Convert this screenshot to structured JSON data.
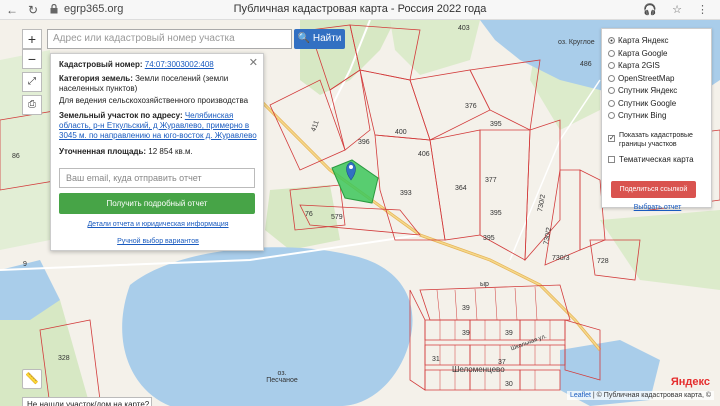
{
  "browser": {
    "url": "egrp365.org",
    "tab_title": "Публичная кадастровая карта - Россия 2022 года"
  },
  "map": {
    "zoom_in": "+",
    "zoom_out": "−",
    "search_placeholder": "Адрес или кадастровый номер участка",
    "search_button": "Найти",
    "not_found_label": "Не нашли участок/дом на карте?",
    "attribution_leaflet": "Leaflet",
    "attribution_rest": "| © Публичная кадастровая карта, ©",
    "yandex_logo": "Яндекс",
    "places": {
      "lake": "оз. Круглое",
      "lake2_line1": "оз.",
      "lake2_line2": "Песчаное",
      "village": "Шеломенцево",
      "village_street": "Школьная ул."
    },
    "parcel_numbers": [
      "376",
      "400",
      "396",
      "406",
      "411",
      "395",
      "393",
      "364",
      "377",
      "395",
      "730/2",
      "730/2",
      "730/3",
      "728",
      "579",
      "76",
      "395",
      "328",
      "39",
      "39",
      "39",
      "37",
      "31",
      "30",
      "403",
      "486",
      "86",
      "9",
      "ыр"
    ],
    "highlight_color": "#3cc75a",
    "water_color": "#a9cdea",
    "boundary_color": "#d23b3b"
  },
  "info_panel": {
    "close": "✕",
    "cadastral_label": "Кадастровый номер:",
    "cadastral_value": "74:07:3003002:408",
    "category_label": "Категория земель:",
    "category_value": "Земли поселений (земли населенных пунктов)",
    "purpose": "Для ведения сельскохозяйственного производства",
    "address_label": "Земельный участок по адресу:",
    "address_value": "Челябинская область, р-н Еткульский, д Журавлево, примерно в 3045 м. по направлению на юго-восток д. Журавлево",
    "area_label": "Уточненная площадь:",
    "area_value": "12 854 кв.м.",
    "email_placeholder": "Ваш email, куда отправить отчет",
    "report_button": "Получить подробный отчет",
    "details_link": "Детали отчета и юридическая информация",
    "manual_link": "Ручной выбор вариантов"
  },
  "layers_panel": {
    "basemaps": [
      {
        "label": "Карта Яндекс",
        "selected": true
      },
      {
        "label": "Карта Google",
        "selected": false
      },
      {
        "label": "Карта 2GIS",
        "selected": false
      },
      {
        "label": "OpenStreetMap",
        "selected": false
      },
      {
        "label": "Спутник Яндекс",
        "selected": false
      },
      {
        "label": "Спутник Google",
        "selected": false
      },
      {
        "label": "Спутник Bing",
        "selected": false
      }
    ],
    "show_boundaries_line1": "Показать кадастровые",
    "show_boundaries_line2": "границы участков",
    "show_boundaries_checked": true,
    "thematic": "Тематическая карта",
    "thematic_checked": false,
    "share_button": "Поделиться ссылкой",
    "share_link": "Выбрать отчет"
  }
}
